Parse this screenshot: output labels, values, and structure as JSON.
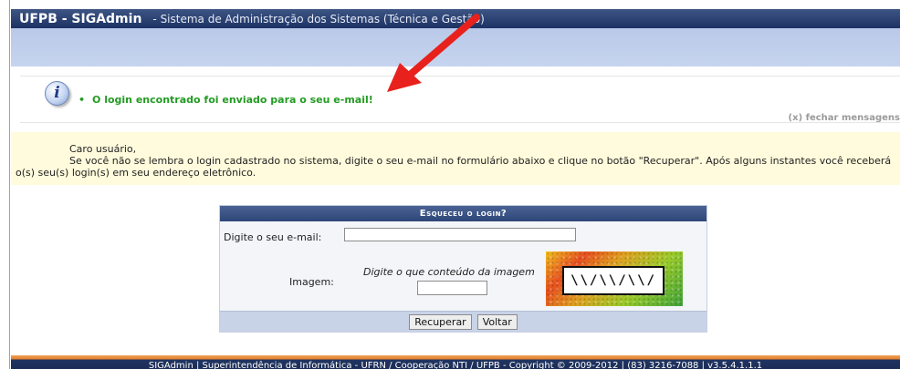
{
  "header": {
    "app_name": "UFPB - SIGAdmin",
    "subtitle": "- Sistema de Administração dos Sistemas (Técnica e Gestão)"
  },
  "message": {
    "text": "O login encontrado foi enviado para o seu e-mail!",
    "close_label": "(x) fechar mensagens",
    "icon": "info-icon"
  },
  "annotation": {
    "icon": "red-arrow",
    "color": "#e8211d"
  },
  "notice": {
    "greeting": "Caro usuário,",
    "body": "Se você não se lembra o login cadastrado no sistema, digite o seu e-mail no formulário abaixo e clique no botão \"Recuperar\". Após alguns instantes você receberá o(s) seu(s) login(s) em seu endereço eletrônico."
  },
  "form": {
    "title": "Esqueceu o login?",
    "email_label": "Digite o seu e-mail:",
    "email_value": "",
    "image_label": "Imagem:",
    "image_hint": "Digite o que conteúdo da imagem",
    "captcha_value": "",
    "captcha_text": "\\\\/\\\\/\\\\/",
    "submit_label": "Recuperar",
    "back_label": "Voltar"
  },
  "footer": {
    "text": "SIGAdmin | Superintendência de Informática - UFRN / Cooperação NTI / UFPB - Copyright © 2009-2012 | (83) 3216-7088 | v3.5.4.1.1.1"
  },
  "colors": {
    "header_bg": "#2a4070",
    "message_green": "#239b23",
    "notice_bg": "#fffbdc",
    "footer_orange": "#e07c28"
  }
}
